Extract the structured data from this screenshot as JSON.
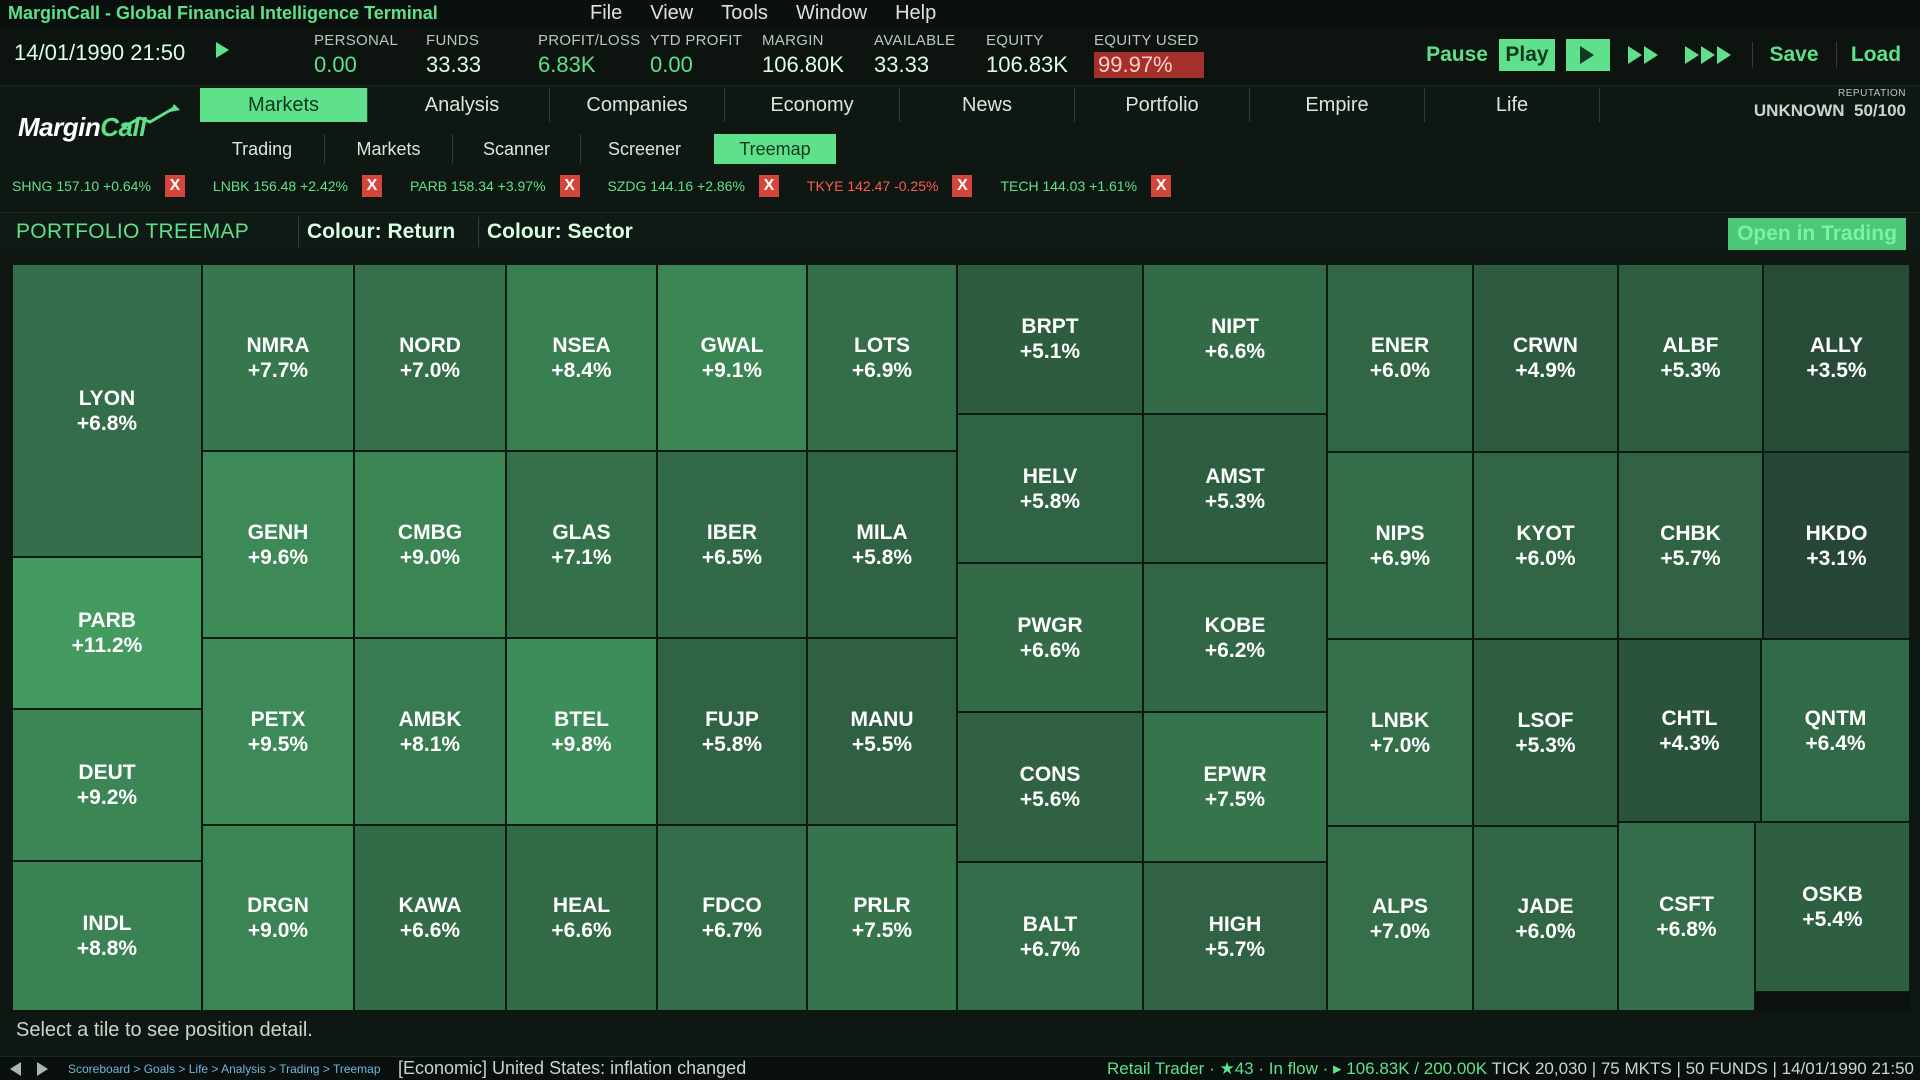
{
  "window": {
    "title": "MarginCall - Global Financial Intelligence Terminal",
    "menu": [
      "File",
      "View",
      "Tools",
      "Window",
      "Help"
    ]
  },
  "stats": {
    "datetime": "14/01/1990 21:50",
    "personal": {
      "label": "PERSONAL",
      "value": "0.00"
    },
    "funds": {
      "label": "FUNDS",
      "value": "33.33"
    },
    "profit_loss": {
      "label": "PROFIT/LOSS",
      "value": "6.83K"
    },
    "ytd_profit": {
      "label": "YTD PROFIT",
      "value": "0.00"
    },
    "margin": {
      "label": "MARGIN",
      "value": "106.80K"
    },
    "available": {
      "label": "AVAILABLE",
      "value": "33.33"
    },
    "equity": {
      "label": "EQUITY",
      "value": "106.83K"
    },
    "equity_used": {
      "label": "EQUITY USED",
      "value": "99.97%"
    }
  },
  "speed_controls": {
    "pause": "Pause",
    "play": "Play",
    "save": "Save",
    "load": "Load"
  },
  "logo": {
    "part1": "Margin",
    "part2": "Call"
  },
  "main_nav": [
    "Markets",
    "Analysis",
    "Companies",
    "Economy",
    "News",
    "Portfolio",
    "Empire",
    "Life"
  ],
  "reputation": {
    "label": "REPUTATION",
    "level": "UNKNOWN",
    "score": "50/100"
  },
  "sub_nav": [
    "Trading",
    "Markets",
    "Scanner",
    "Screener",
    "Treemap"
  ],
  "watchlist": [
    {
      "text": "SHNG 157.10 +0.64%",
      "neg": false
    },
    {
      "text": "LNBK 156.48 +2.42%",
      "neg": false
    },
    {
      "text": "PARB 158.34 +3.97%",
      "neg": false
    },
    {
      "text": "SZDG 144.16 +2.86%",
      "neg": false
    },
    {
      "text": "TKYE 142.47 -0.25%",
      "neg": true
    },
    {
      "text": "TECH 144.03 +1.61%",
      "neg": false
    }
  ],
  "watchlist_close": "X",
  "panel": {
    "title": "PORTFOLIO TREEMAP",
    "colour_return": "Colour: Return",
    "colour_sector": "Colour: Sector",
    "open_trading": "Open in Trading"
  },
  "treemap": [
    {
      "ticker": "LYON",
      "ret": "+6.8%"
    },
    {
      "ticker": "PARB",
      "ret": "+11.2%"
    },
    {
      "ticker": "DEUT",
      "ret": "+9.2%"
    },
    {
      "ticker": "INDL",
      "ret": "+8.8%"
    },
    {
      "ticker": "NMRA",
      "ret": "+7.7%"
    },
    {
      "ticker": "NORD",
      "ret": "+7.0%"
    },
    {
      "ticker": "NSEA",
      "ret": "+8.4%"
    },
    {
      "ticker": "GWAL",
      "ret": "+9.1%"
    },
    {
      "ticker": "LOTS",
      "ret": "+6.9%"
    },
    {
      "ticker": "GENH",
      "ret": "+9.6%"
    },
    {
      "ticker": "CMBG",
      "ret": "+9.0%"
    },
    {
      "ticker": "GLAS",
      "ret": "+7.1%"
    },
    {
      "ticker": "IBER",
      "ret": "+6.5%"
    },
    {
      "ticker": "MILA",
      "ret": "+5.8%"
    },
    {
      "ticker": "PETX",
      "ret": "+9.5%"
    },
    {
      "ticker": "AMBK",
      "ret": "+8.1%"
    },
    {
      "ticker": "BTEL",
      "ret": "+9.8%"
    },
    {
      "ticker": "FUJP",
      "ret": "+5.8%"
    },
    {
      "ticker": "MANU",
      "ret": "+5.5%"
    },
    {
      "ticker": "DRGN",
      "ret": "+9.0%"
    },
    {
      "ticker": "KAWA",
      "ret": "+6.6%"
    },
    {
      "ticker": "HEAL",
      "ret": "+6.6%"
    },
    {
      "ticker": "FDCO",
      "ret": "+6.7%"
    },
    {
      "ticker": "PRLR",
      "ret": "+7.5%"
    },
    {
      "ticker": "BRPT",
      "ret": "+5.1%"
    },
    {
      "ticker": "NIPT",
      "ret": "+6.6%"
    },
    {
      "ticker": "HELV",
      "ret": "+5.8%"
    },
    {
      "ticker": "AMST",
      "ret": "+5.3%"
    },
    {
      "ticker": "PWGR",
      "ret": "+6.6%"
    },
    {
      "ticker": "KOBE",
      "ret": "+6.2%"
    },
    {
      "ticker": "CONS",
      "ret": "+5.6%"
    },
    {
      "ticker": "EPWR",
      "ret": "+7.5%"
    },
    {
      "ticker": "BALT",
      "ret": "+6.7%"
    },
    {
      "ticker": "HIGH",
      "ret": "+5.7%"
    },
    {
      "ticker": "ENER",
      "ret": "+6.0%"
    },
    {
      "ticker": "CRWN",
      "ret": "+4.9%"
    },
    {
      "ticker": "ALBF",
      "ret": "+5.3%"
    },
    {
      "ticker": "ALLY",
      "ret": "+3.5%"
    },
    {
      "ticker": "NIPS",
      "ret": "+6.9%"
    },
    {
      "ticker": "KYOT",
      "ret": "+6.0%"
    },
    {
      "ticker": "CHBK",
      "ret": "+5.7%"
    },
    {
      "ticker": "HKDO",
      "ret": "+3.1%"
    },
    {
      "ticker": "LNBK",
      "ret": "+7.0%"
    },
    {
      "ticker": "LSOF",
      "ret": "+5.3%"
    },
    {
      "ticker": "CHTL",
      "ret": "+4.3%"
    },
    {
      "ticker": "QNTM",
      "ret": "+6.4%"
    },
    {
      "ticker": "ALPS",
      "ret": "+7.0%"
    },
    {
      "ticker": "JADE",
      "ret": "+6.0%"
    },
    {
      "ticker": "CSFT",
      "ret": "+6.8%"
    },
    {
      "ticker": "OSKB",
      "ret": "+5.4%"
    }
  ],
  "hint": "Select a tile to see position detail.",
  "footer": {
    "breadcrumb": "Scoreboard > Goals > Life > Analysis > Trading > Treemap",
    "event": "[Economic] United States: inflation changed",
    "rank": "Retail Trader",
    "stars": "★43",
    "flow": "In flow",
    "equity_progress": "106.83K / 200.00K",
    "tick": "TICK 20,030",
    "markets": "75 MKTS",
    "funds": "50 FUNDS",
    "datetime": "14/01/1990 21:50"
  },
  "colors": {
    "accent": "#5fe08a",
    "negative": "#ff5b4d",
    "warning_bg": "#a3302b",
    "breadcrumb": "#6fb6e0"
  }
}
